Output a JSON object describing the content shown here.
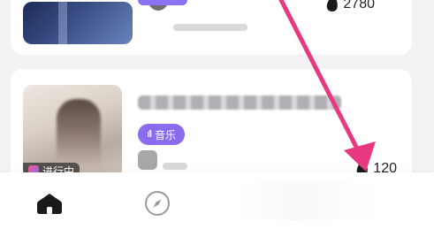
{
  "feed": {
    "items": [
      {
        "hot_count": "2780"
      },
      {
        "tag_label": "音乐",
        "thumb_badge": "进行中",
        "hot_count": "120"
      }
    ]
  },
  "tabbar": {
    "items": [
      {
        "icon": "home-icon",
        "active": true
      },
      {
        "icon": "compass-icon",
        "active": false
      }
    ]
  },
  "colors": {
    "accent": "#8a6cf0",
    "annotation_arrow": "#e8387f",
    "background": "#f3f3f6"
  }
}
